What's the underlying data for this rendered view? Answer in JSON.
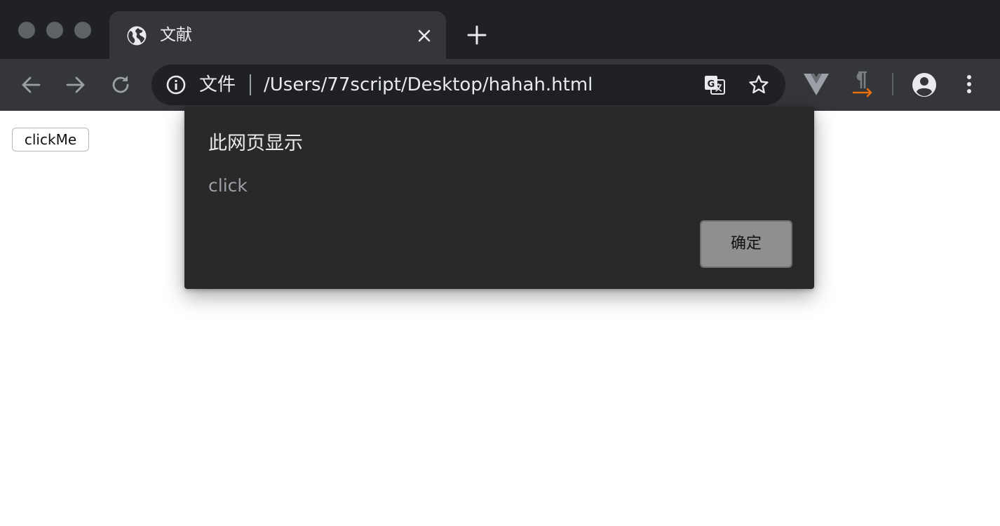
{
  "tab": {
    "title": "文献"
  },
  "omnibox": {
    "scheme_label": "文件",
    "url": "/Users/77script/Desktop/hahah.html"
  },
  "page": {
    "button_label": "clickMe"
  },
  "dialog": {
    "title": "此网页显示",
    "message": "click",
    "ok_label": "确定"
  },
  "colors": {
    "tabstrip_bg": "#202124",
    "toolbar_bg": "#35363a",
    "dialog_bg": "#292929",
    "extension_accent": "#e8710a"
  },
  "icons": {
    "tab_favicon": "globe-icon",
    "tab_close": "close-icon",
    "new_tab": "plus-icon",
    "back": "arrow-left-icon",
    "forward": "arrow-right-icon",
    "reload": "reload-icon",
    "site_info": "info-icon",
    "translate": "translate-icon",
    "bookmark": "star-icon",
    "extension_1": "vue-devtools-icon",
    "extension_2": "pilcrow-icon",
    "profile": "profile-icon",
    "menu": "kebab-menu-icon"
  }
}
